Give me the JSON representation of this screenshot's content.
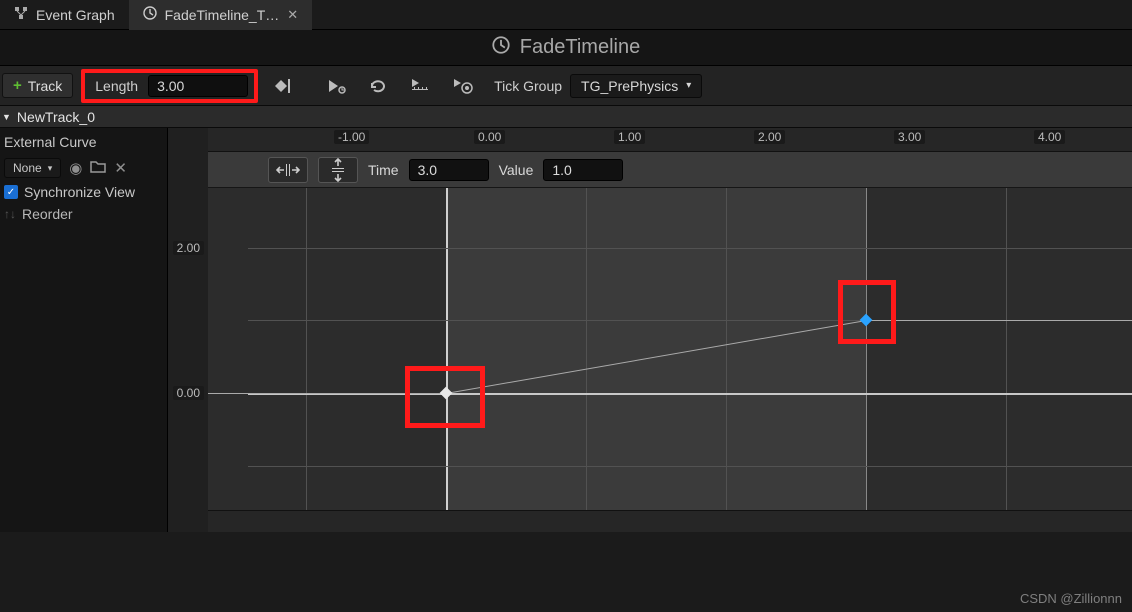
{
  "tabs": {
    "event_graph": "Event Graph",
    "timeline": "FadeTimeline_T…"
  },
  "title": "FadeTimeline",
  "toolbar": {
    "track_btn": "Track",
    "length_label": "Length",
    "length_value": "3.00",
    "tick_group_label": "Tick Group",
    "tick_group_value": "TG_PrePhysics"
  },
  "track_header": "NewTrack_0",
  "sidebar": {
    "external_curve": "External Curve",
    "curve_dd": "None",
    "sync_view": "Synchronize View",
    "reorder": "Reorder"
  },
  "curve_toolbar": {
    "time_label": "Time",
    "time_value": "3.0",
    "value_label": "Value",
    "value_value": "1.0"
  },
  "time_ticks": [
    "-1.00",
    "0.00",
    "1.00",
    "2.00",
    "3.00",
    "4.00"
  ],
  "y_ticks": [
    "0.00",
    "2.00"
  ],
  "chart_data": {
    "type": "line",
    "x": [
      0.0,
      3.0
    ],
    "y": [
      0.0,
      1.0
    ],
    "xlim": [
      -2.0,
      5.0
    ],
    "ylim": [
      -1.0,
      3.0
    ],
    "xlabel": "Time",
    "ylabel": "Value",
    "length": 3.0,
    "selected_key": {
      "time": 3.0,
      "value": 1.0
    }
  },
  "footer": "CSDN @Zillionnn"
}
